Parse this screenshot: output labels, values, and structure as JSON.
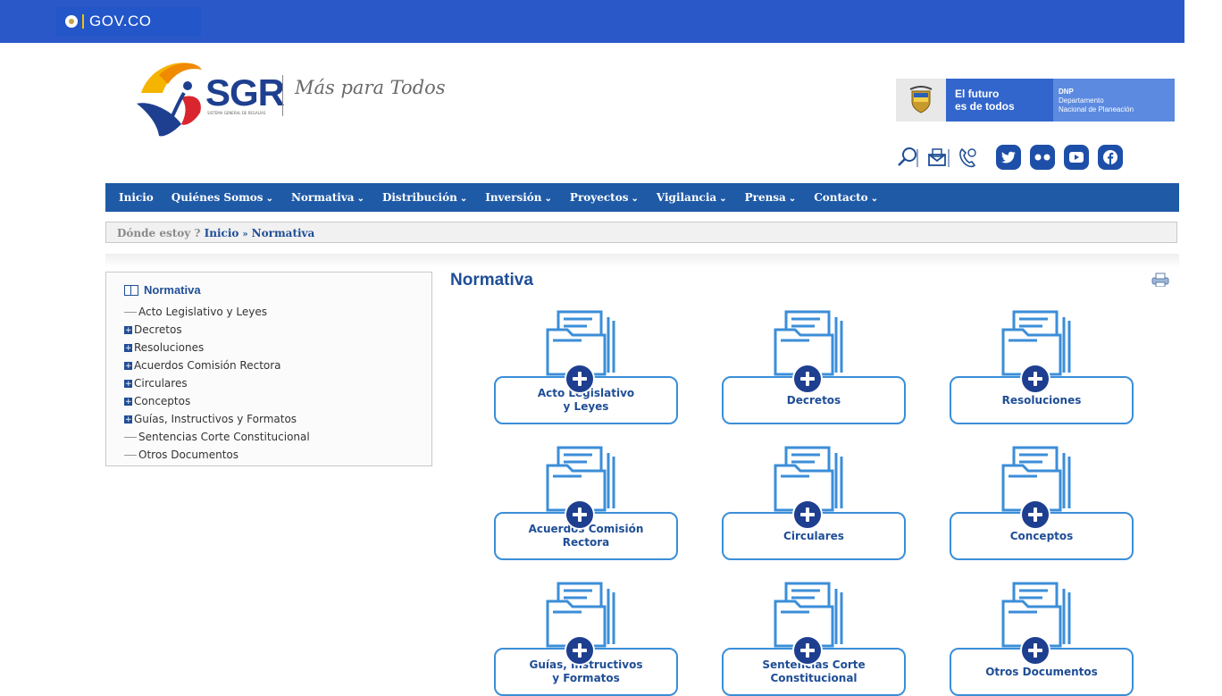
{
  "govbar": {
    "label": "GOV.CO"
  },
  "header": {
    "brand": "SGR",
    "brand_sub": "SISTEMA GENERAL DE REGALÍAS",
    "slogan": "Más para Todos",
    "partner_mid_1": "El futuro",
    "partner_mid_2": "es de todos",
    "partner_right_1": "DNP",
    "partner_right_2": "Departamento",
    "partner_right_3": "Nacional de Planeación"
  },
  "social": {
    "icons": [
      "search-icon",
      "mail-icon",
      "phone-support-icon",
      "twitter-icon",
      "flickr-icon",
      "youtube-icon",
      "facebook-icon"
    ]
  },
  "nav": {
    "items": [
      {
        "label": "Inicio",
        "dropdown": false
      },
      {
        "label": "Quiénes Somos",
        "dropdown": true
      },
      {
        "label": "Normativa",
        "dropdown": true
      },
      {
        "label": "Distribución",
        "dropdown": true
      },
      {
        "label": "Inversión",
        "dropdown": true
      },
      {
        "label": "Proyectos",
        "dropdown": true
      },
      {
        "label": "Vigilancia",
        "dropdown": true
      },
      {
        "label": "Prensa",
        "dropdown": true
      },
      {
        "label": "Contacto",
        "dropdown": true
      }
    ]
  },
  "breadcrumb": {
    "label": "Dónde estoy ?",
    "home": "Inicio",
    "separator": "»",
    "current": "Normativa"
  },
  "sidebar": {
    "title": "Normativa",
    "items": [
      {
        "label": "Acto Legislativo y Leyes",
        "expandable": false
      },
      {
        "label": "Decretos",
        "expandable": true
      },
      {
        "label": "Resoluciones",
        "expandable": true
      },
      {
        "label": "Acuerdos Comisión Rectora",
        "expandable": true
      },
      {
        "label": "Circulares",
        "expandable": true
      },
      {
        "label": "Conceptos",
        "expandable": true
      },
      {
        "label": "Guías, Instructivos y Formatos",
        "expandable": true
      },
      {
        "label": "Sentencias Corte Constitucional",
        "expandable": false
      },
      {
        "label": "Otros Documentos",
        "expandable": false
      }
    ]
  },
  "main": {
    "title": "Normativa",
    "cards": [
      {
        "line1": "Acto Legislativo",
        "line2": "y Leyes"
      },
      {
        "line1": "Decretos",
        "line2": ""
      },
      {
        "line1": "Resoluciones",
        "line2": ""
      },
      {
        "line1": "Acuerdos Comisión",
        "line2": "Rectora"
      },
      {
        "line1": "Circulares",
        "line2": ""
      },
      {
        "line1": "Conceptos",
        "line2": ""
      },
      {
        "line1": "Guías, Instructivos",
        "line2": "y Formatos"
      },
      {
        "line1": "Sentencias Corte",
        "line2": "Constitucional"
      },
      {
        "line1": "Otros Documentos",
        "line2": ""
      }
    ]
  },
  "colors": {
    "govbar": "#2a58c8",
    "nav": "#1f5aa7",
    "accent": "#1f4e96",
    "card_border": "#3b8ed8",
    "plus_circle": "#1e3f8f"
  }
}
